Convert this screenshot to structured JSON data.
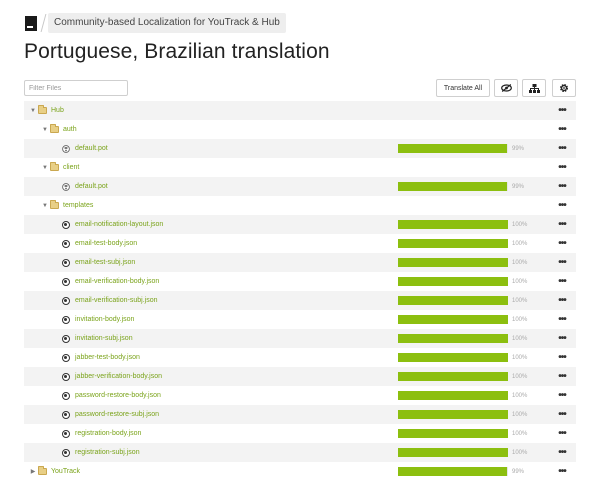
{
  "breadcrumb": {
    "project": "Community-based Localization for YouTrack & Hub"
  },
  "page_title": "Portuguese, Brazilian translation",
  "toolbar": {
    "filter_placeholder": "Filter Files",
    "translate_all": "Translate All",
    "hide_icon": "eye-slash-icon",
    "tree_icon": "hierarchy-icon",
    "settings_icon": "gear-icon"
  },
  "more_label": "•••",
  "rows": [
    {
      "kind": "folder",
      "depth": 0,
      "expanded": true,
      "name": "Hub"
    },
    {
      "kind": "folder",
      "depth": 1,
      "expanded": true,
      "name": "auth"
    },
    {
      "kind": "pot",
      "depth": 2,
      "name": "default.pot",
      "progress": 99,
      "percent_label": "99%"
    },
    {
      "kind": "folder",
      "depth": 1,
      "expanded": true,
      "name": "client"
    },
    {
      "kind": "pot",
      "depth": 2,
      "name": "default.pot",
      "progress": 99,
      "percent_label": "99%"
    },
    {
      "kind": "folder",
      "depth": 1,
      "expanded": true,
      "name": "templates"
    },
    {
      "kind": "json",
      "depth": 2,
      "name": "email-notification-layout.json",
      "progress": 100,
      "percent_label": "100%"
    },
    {
      "kind": "json",
      "depth": 2,
      "name": "email-test-body.json",
      "progress": 100,
      "percent_label": "100%"
    },
    {
      "kind": "json",
      "depth": 2,
      "name": "email-test-subj.json",
      "progress": 100,
      "percent_label": "100%"
    },
    {
      "kind": "json",
      "depth": 2,
      "name": "email-verification-body.json",
      "progress": 100,
      "percent_label": "100%"
    },
    {
      "kind": "json",
      "depth": 2,
      "name": "email-verification-subj.json",
      "progress": 100,
      "percent_label": "100%"
    },
    {
      "kind": "json",
      "depth": 2,
      "name": "invitation-body.json",
      "progress": 100,
      "percent_label": "100%"
    },
    {
      "kind": "json",
      "depth": 2,
      "name": "invitation-subj.json",
      "progress": 100,
      "percent_label": "100%"
    },
    {
      "kind": "json",
      "depth": 2,
      "name": "jabber-test-body.json",
      "progress": 100,
      "percent_label": "100%"
    },
    {
      "kind": "json",
      "depth": 2,
      "name": "jabber-verification-body.json",
      "progress": 100,
      "percent_label": "100%"
    },
    {
      "kind": "json",
      "depth": 2,
      "name": "password-restore-body.json",
      "progress": 100,
      "percent_label": "100%"
    },
    {
      "kind": "json",
      "depth": 2,
      "name": "password-restore-subj.json",
      "progress": 100,
      "percent_label": "100%"
    },
    {
      "kind": "json",
      "depth": 2,
      "name": "registration-body.json",
      "progress": 100,
      "percent_label": "100%"
    },
    {
      "kind": "json",
      "depth": 2,
      "name": "registration-subj.json",
      "progress": 100,
      "percent_label": "100%"
    },
    {
      "kind": "folder",
      "depth": 0,
      "expanded": false,
      "name": "YouTrack",
      "progress": 99,
      "percent_label": "99%"
    }
  ],
  "colors": {
    "progress_fill": "#8cbf0f",
    "link": "#7aa31a",
    "folder": "#e8cf86"
  }
}
